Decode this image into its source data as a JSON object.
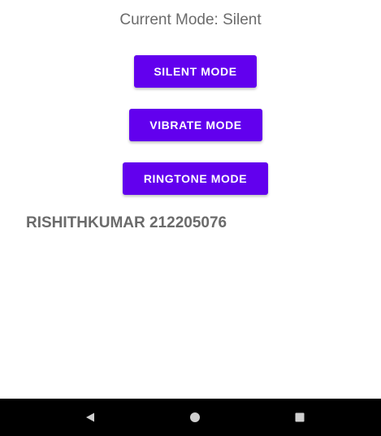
{
  "status": {
    "current_mode_text": "Current Mode: Silent"
  },
  "buttons": {
    "silent_label": "SILENT MODE",
    "vibrate_label": "VIBRATE MODE",
    "ringtone_label": "RINGTONE MODE"
  },
  "footer": {
    "name_text": "RISHITHKUMAR 212205076"
  },
  "navigation": {
    "icons": [
      "back-icon",
      "home-icon",
      "recents-icon"
    ]
  },
  "colors": {
    "button_bg": "#6200ee",
    "button_text": "#ffffff",
    "text_gray": "#6b6b6b",
    "nav_bar_bg": "#000000",
    "nav_icon": "#cfcfcf"
  }
}
